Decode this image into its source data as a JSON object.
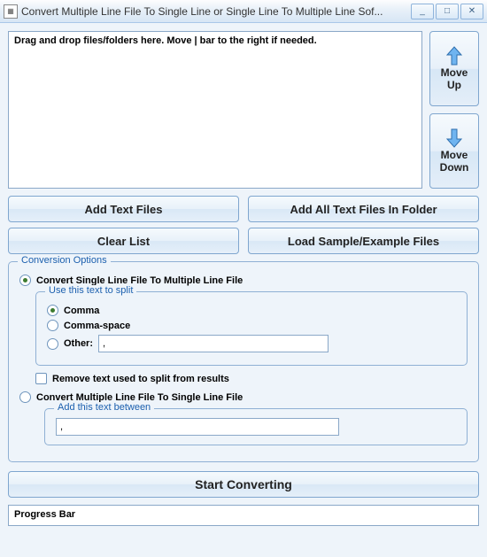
{
  "window": {
    "title": "Convert Multiple Line File To Single Line or Single Line To Multiple Line Sof..."
  },
  "dropArea": {
    "hint": "Drag and drop files/folders here. Move | bar to the right if needed."
  },
  "moveButtons": {
    "up": "Move\nUp",
    "down": "Move\nDown"
  },
  "buttons": {
    "addTextFiles": "Add Text Files",
    "addAllInFolder": "Add All Text Files In Folder",
    "clearList": "Clear List",
    "loadSample": "Load Sample/Example Files"
  },
  "conversion": {
    "legend": "Conversion Options",
    "singleToMultiple": {
      "label": "Convert Single Line File To Multiple Line File",
      "selected": true,
      "splitBox": {
        "legend": "Use this text to split",
        "comma": {
          "label": "Comma",
          "selected": true
        },
        "commaSpace": {
          "label": "Comma-space",
          "selected": false
        },
        "other": {
          "label": "Other:",
          "selected": false,
          "value": ","
        }
      },
      "removeText": {
        "label": "Remove text used to split from results",
        "checked": false
      }
    },
    "multipleToSingle": {
      "label": "Convert Multiple Line File To Single Line File",
      "selected": false,
      "betweenBox": {
        "legend": "Add this text between",
        "value": ","
      }
    }
  },
  "start": {
    "label": "Start Converting"
  },
  "progress": {
    "label": "Progress Bar"
  }
}
